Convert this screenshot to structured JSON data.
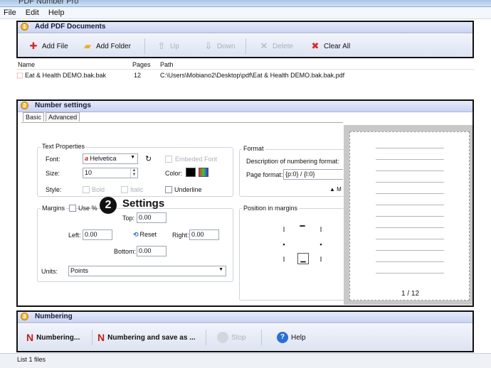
{
  "window": {
    "title": "PDF Number Pro"
  },
  "menu": [
    "File",
    "Edit",
    "Help"
  ],
  "panels": {
    "add": {
      "num": "1",
      "title": "Add PDF Documents"
    },
    "settings": {
      "num": "2",
      "title": "Number settings"
    },
    "numbering": {
      "num": "3",
      "title": "Numbering"
    }
  },
  "toolbar": {
    "add_file": "Add File",
    "add_folder": "Add Folder",
    "up": "Up",
    "down": "Down",
    "delete": "Delete",
    "clear_all": "Clear All"
  },
  "file_list": {
    "columns": [
      "Name",
      "Pages",
      "Path"
    ],
    "rows": [
      {
        "name": "Eat & Health DEMO.bak.bak",
        "pages": "12",
        "path": "C:\\Users\\Mobiano2\\Desktop\\pdf\\Eat & Health DEMO.bak.bak.pdf"
      }
    ]
  },
  "tabs": [
    "Basic",
    "Advanced"
  ],
  "text_properties": {
    "title": "Text Properties",
    "font_label": "Font:",
    "font_value": "Helvetica",
    "embedded_font": "Embeded Font",
    "size_label": "Size:",
    "size_value": "10",
    "color_label": "Color:",
    "style_label": "Style:",
    "bold": "Bold",
    "italic": "Italic",
    "underline": "Underline"
  },
  "format": {
    "title": "Format",
    "desc": "Description of numbering format:",
    "page_format_label": "Page format:",
    "page_format_value": "{p:0} / {l:0}",
    "more": "▲ M"
  },
  "margins": {
    "title": "Margins",
    "use_pct": "Use %",
    "top_label": "Top:",
    "top_value": "0.00",
    "left_label": "Left:",
    "left_value": "0.00",
    "reset": "Reset",
    "right_label": "Right:",
    "right_value": "0.00",
    "bottom_label": "Bottom:",
    "bottom_value": "0.00",
    "units_label": "Units:",
    "units_value": "Points"
  },
  "position": {
    "title": "Position in margins"
  },
  "preview": {
    "page": "1 / 12"
  },
  "annotation": {
    "badge": "2",
    "text": "Settings"
  },
  "actions": {
    "numbering": "Numbering...",
    "numbering_save": "Numbering and save as ...",
    "stop": "Stop",
    "help": "Help"
  },
  "status": "List 1 files",
  "colors": {
    "accent": "#c9d3f1",
    "frame": "#111111",
    "number_badge": "#e99a12"
  }
}
